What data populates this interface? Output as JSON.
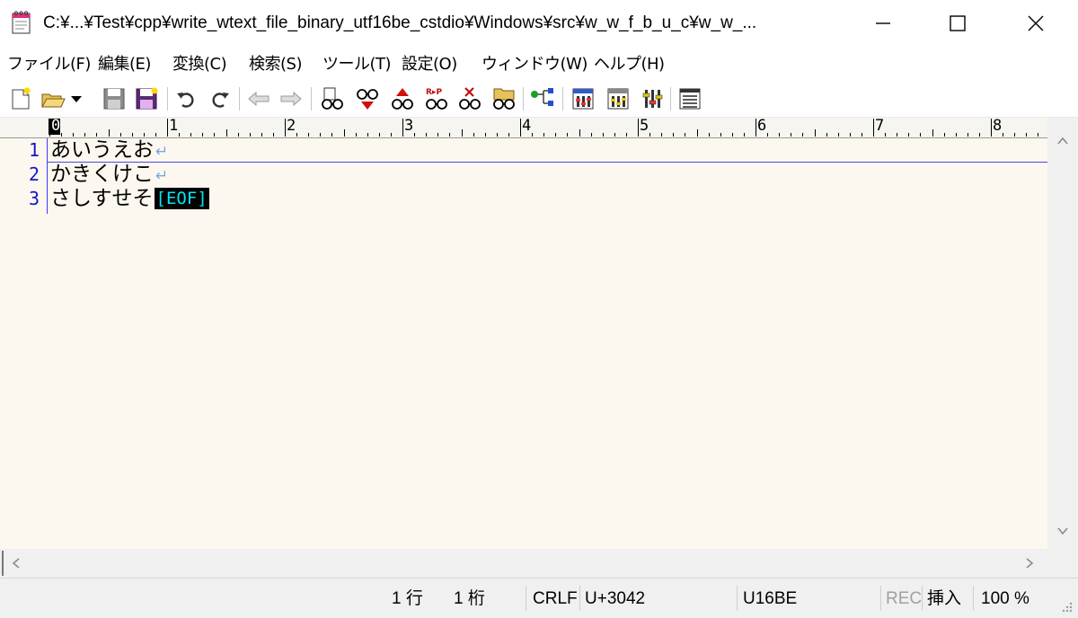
{
  "window": {
    "title": "C:¥...¥Test¥cpp¥write_wtext_file_binary_utf16be_cstdio¥Windows¥src¥w_w_f_b_u_c¥w_w_...",
    "app_icon": "notepad-icon",
    "controls": [
      "minimize-icon",
      "maximize-icon",
      "close-icon"
    ]
  },
  "menu": {
    "items": [
      {
        "label": "ファイル(F)"
      },
      {
        "label": "編集(E)"
      },
      {
        "label": "変換(C)"
      },
      {
        "label": "検索(S)"
      },
      {
        "label": "ツール(T)"
      },
      {
        "label": "設定(O)"
      },
      {
        "label": "ウィンドウ(W)"
      },
      {
        "label": "ヘルプ(H)"
      }
    ]
  },
  "toolbar": {
    "icons": [
      "new-file-icon",
      "open-file-icon",
      "dropdown-arrow-icon",
      "save-icon",
      "save-all-icon",
      "undo-icon",
      "redo-icon",
      "back-icon",
      "forward-icon",
      "find-icon",
      "find-prev-icon",
      "find-next-icon",
      "replace-icon",
      "clear-highlight-icon",
      "grep-icon",
      "outline-icon",
      "settings-common-icon",
      "settings-type-icon",
      "font-icon",
      "window-list-icon"
    ]
  },
  "ruler": {
    "labels": [
      "0",
      "1",
      "2",
      "3",
      "4",
      "5",
      "6",
      "7",
      "8"
    ]
  },
  "editor": {
    "lines": [
      {
        "no": "1",
        "text": "あいうえお",
        "eol": "↵"
      },
      {
        "no": "2",
        "text": "かきくけこ",
        "eol": "↵"
      },
      {
        "no": "3",
        "text": "さしすせそ",
        "eof": "[EOF]"
      }
    ]
  },
  "status": {
    "row": "1 行",
    "col": "1 桁",
    "eol_type": "CRLF",
    "char_code": "U+3042",
    "encoding": "U16BE",
    "rec": "REC",
    "mode": "挿入",
    "zoom": "100 %"
  }
}
